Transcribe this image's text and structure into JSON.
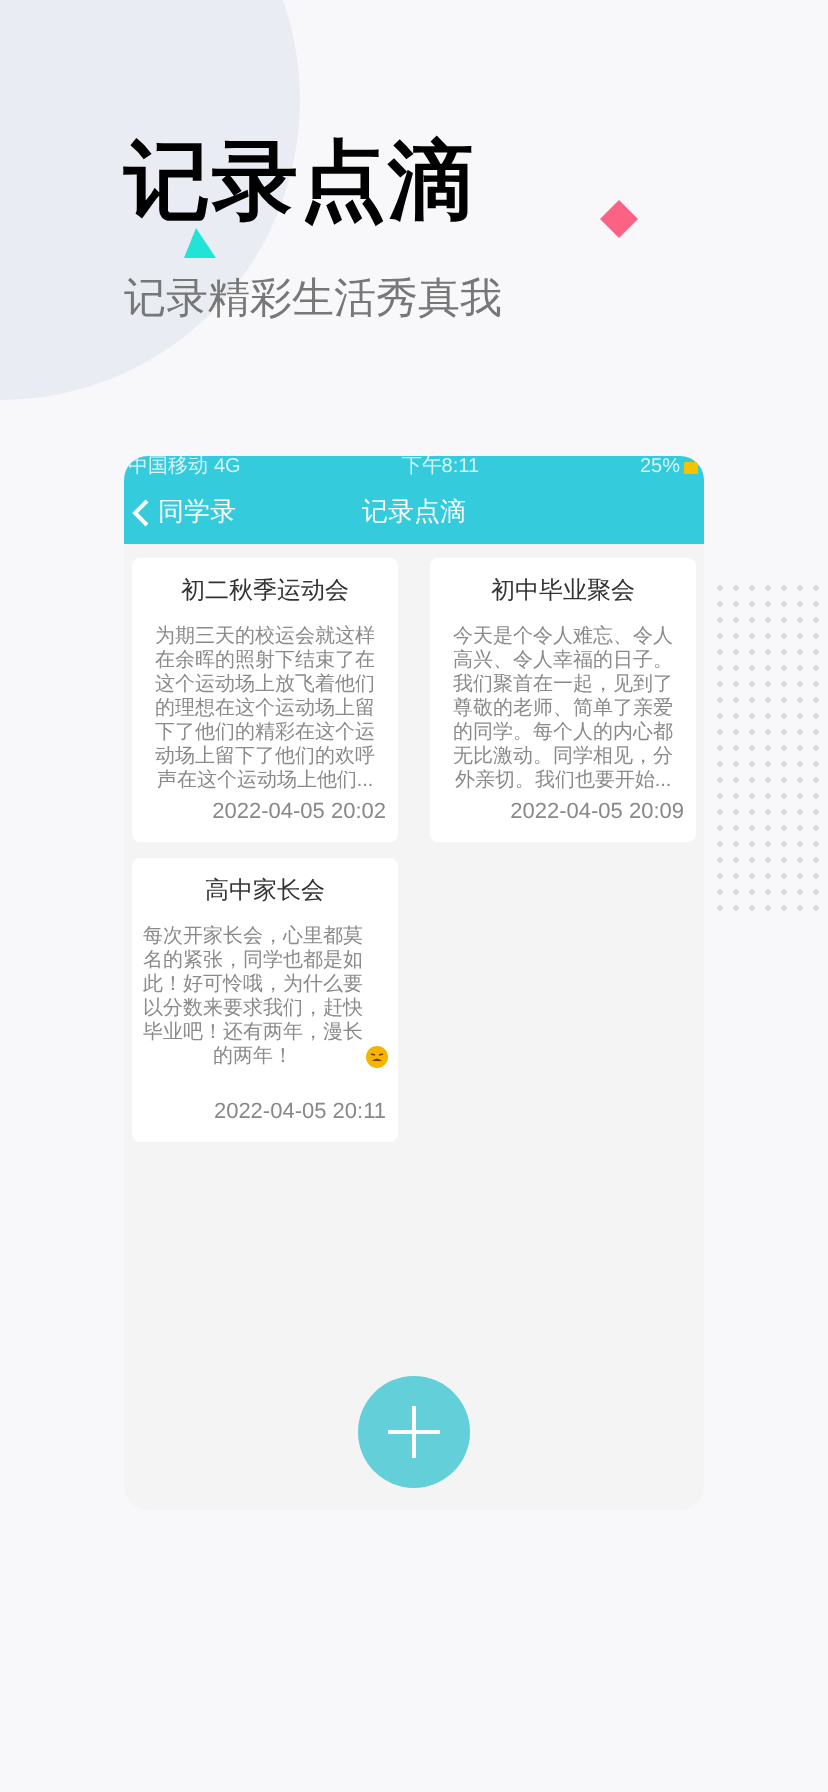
{
  "headline": "记录点滴",
  "tagline": "记录精彩生活秀真我",
  "status_bar": {
    "carrier": "中国移动",
    "network": "4G",
    "time": "下午8:11",
    "battery": "25%"
  },
  "nav": {
    "back_label": "同学录",
    "title": "记录点滴"
  },
  "notes": [
    {
      "title": "初二秋季运动会",
      "body": "为期三天的校运会就这样在余晖的照射下结束了在这个运动场上放飞着他们的理想在这个运动场上留下了他们的精彩在这个运动场上留下了他们的欢呼声在这个运动场上他们...",
      "emoji": false,
      "time": "2022-04-05 20:02"
    },
    {
      "title": "初中毕业聚会",
      "body": "今天是个令人难忘、令人高兴、令人幸福的日子。我们聚首在一起，见到了尊敬的老师、简单了亲爱的同学。每个人的内心都无比激动。同学相见，分外亲切。我们也要开始...",
      "emoji": false,
      "time": "2022-04-05 20:09"
    },
    {
      "title": "高中家长会",
      "body": "每次开家长会，心里都莫名的紧张，同学也都是如此！好可怜哦，为什么要以分数来要求我们，赶快毕业吧！还有两年，漫长的两年！",
      "emoji": true,
      "time": "2022-04-05 20:11"
    }
  ]
}
